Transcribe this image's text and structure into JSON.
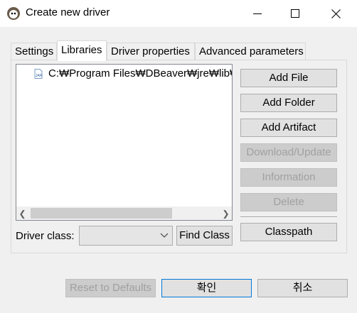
{
  "window": {
    "title": "Create new driver"
  },
  "tabs": [
    {
      "label": "Settings",
      "active": false
    },
    {
      "label": "Libraries",
      "active": true
    },
    {
      "label": "Driver properties",
      "active": false
    },
    {
      "label": "Advanced parameters",
      "active": false
    }
  ],
  "libraries": {
    "items": [
      {
        "icon": "jar-file-icon",
        "path": "C:₩Program Files₩DBeaver₩jre₩lib₩ti"
      }
    ]
  },
  "side_buttons": {
    "add_file": "Add File",
    "add_folder": "Add Folder",
    "add_artifact": "Add Artifact",
    "download_update": "Download/Update",
    "information": "Information",
    "delete": "Delete",
    "classpath": "Classpath"
  },
  "driver_class": {
    "label": "Driver class:",
    "value": "",
    "find_button": "Find Class"
  },
  "footer": {
    "reset": "Reset to Defaults",
    "ok": "확인",
    "cancel": "취소"
  },
  "colors": {
    "accent": "#0078d7",
    "disabled_text": "#a0a0a0"
  }
}
